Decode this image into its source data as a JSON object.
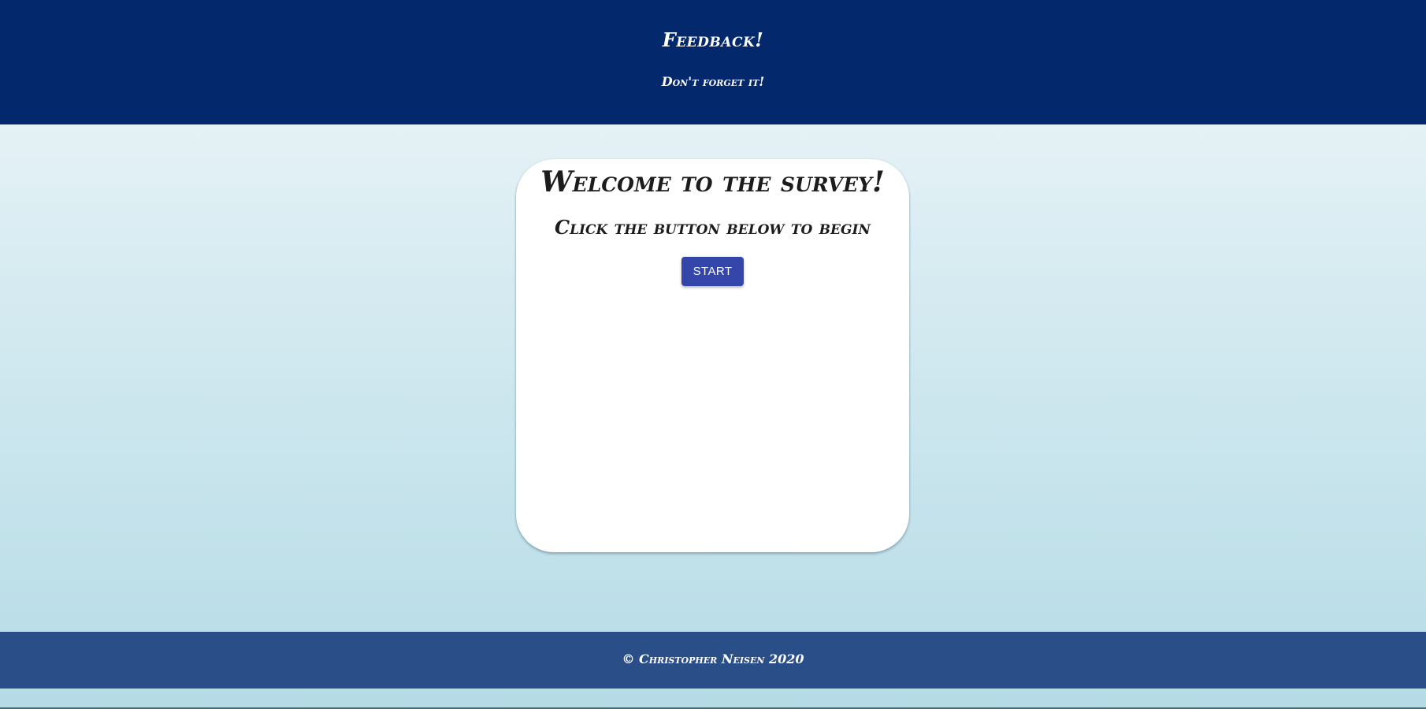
{
  "header": {
    "title": "Feedback!",
    "subtitle": "Don't forget it!"
  },
  "card": {
    "title": "Welcome to the survey!",
    "subtitle": "Click the button below to begin",
    "start_label": "START"
  },
  "footer": {
    "copyright": "© Christopher Neisen 2020"
  },
  "colors": {
    "header_bg": "#03286b",
    "footer_bg": "#2a4e87",
    "button_bg": "#3546ab",
    "background_top": "#f0f7f9",
    "background_bottom": "#b5dbe6"
  }
}
